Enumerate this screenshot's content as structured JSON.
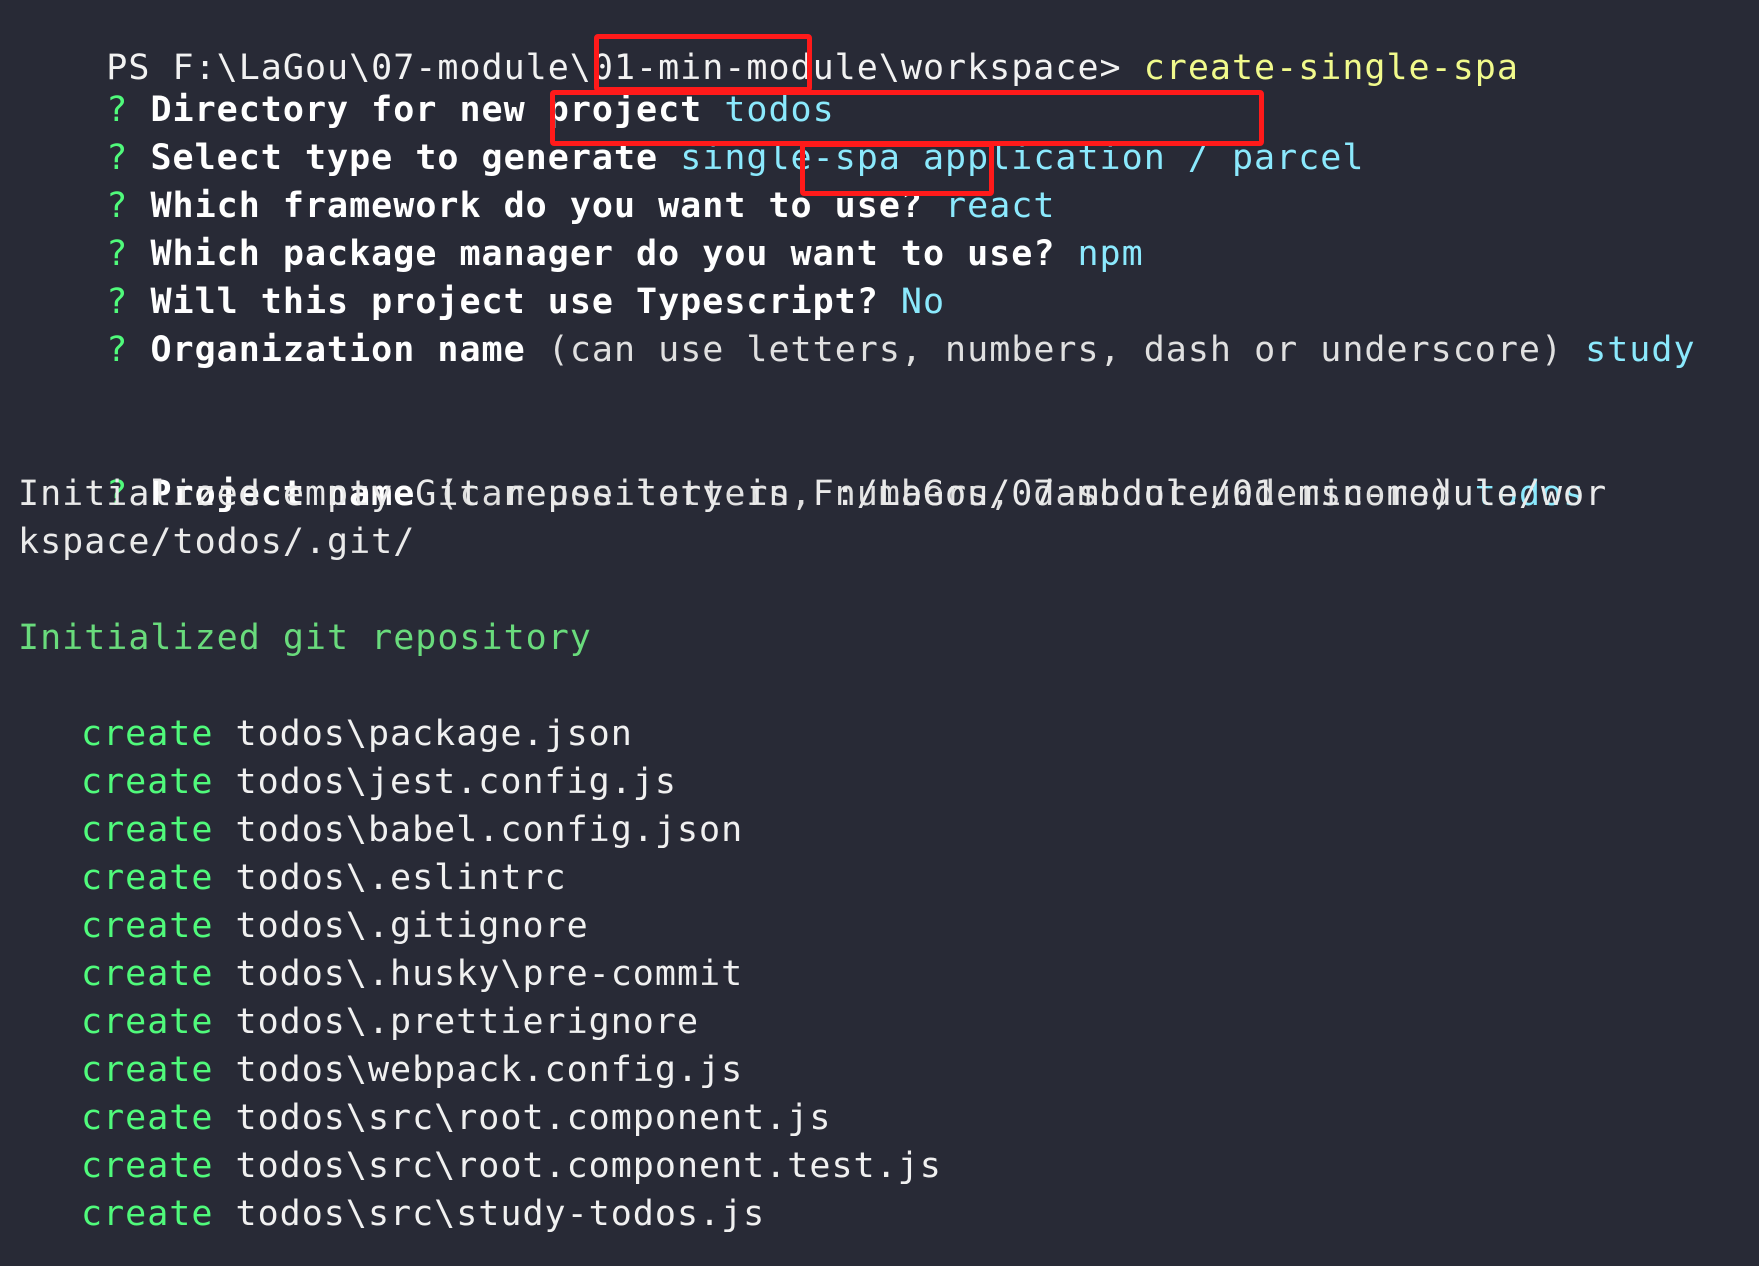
{
  "prompt": {
    "ps_path": "PS F:\\LaGou\\07-module\\01-min-module\\workspace>",
    "command": "create-single-spa"
  },
  "questions": [
    {
      "mark": "?",
      "label": "Directory for new project",
      "hint": "",
      "answer": "todos"
    },
    {
      "mark": "?",
      "label": "Select type to generate",
      "hint": "",
      "answer": "single-spa application / parcel"
    },
    {
      "mark": "?",
      "label": "Which framework do you want to use?",
      "hint": "",
      "answer": "react"
    },
    {
      "mark": "?",
      "label": "Which package manager do you want to use?",
      "hint": "",
      "answer": "npm"
    },
    {
      "mark": "?",
      "label": "Will this project use Typescript?",
      "hint": "",
      "answer": "No"
    },
    {
      "mark": "?",
      "label": "Organization name",
      "hint": "(can use letters, numbers, dash or underscore)",
      "answer": "study"
    },
    {
      "mark": "?",
      "label": "Project name",
      "hint": "(can use letters, numbers, dash or underscore)",
      "answer": "todos"
    }
  ],
  "git_init": {
    "line1": "Initialized empty Git repository in F:/LaGou/07-module/01-min-module/wor",
    "line2": "kspace/todos/.git/",
    "success": "Initialized git repository"
  },
  "create_keyword": "create",
  "created_files": [
    "todos\\package.json",
    "todos\\jest.config.js",
    "todos\\babel.config.json",
    "todos\\.eslintrc",
    "todos\\.gitignore",
    "todos\\.husky\\pre-commit",
    "todos\\.prettierignore",
    "todos\\webpack.config.js",
    "todos\\src\\root.component.js",
    "todos\\src\\root.component.test.js",
    "todos\\src\\study-todos.js"
  ],
  "colors": {
    "background": "#282a36",
    "question_mark": "#50fa7b",
    "answer": "#8be9fd",
    "command": "#f1fa8c",
    "highlight_box": "#ff1a1a"
  }
}
